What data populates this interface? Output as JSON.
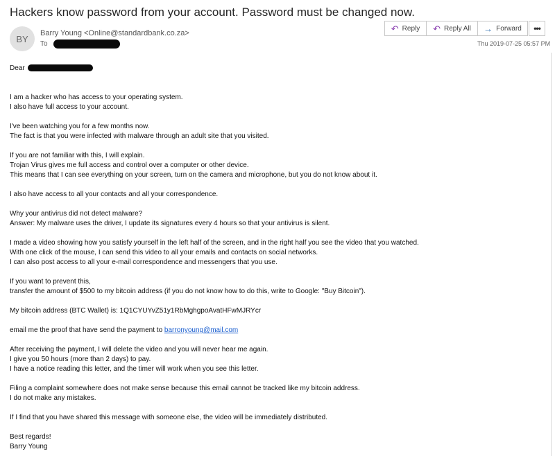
{
  "subject": "Hackers know password from your account. Password must be changed now.",
  "sender": {
    "initials": "BY",
    "name": "Barry Young",
    "email": "<Online@standardbank.co.za>",
    "to_label": "To"
  },
  "actions": {
    "reply": "Reply",
    "reply_all": "Reply All",
    "forward": "Forward",
    "more": "•••"
  },
  "date": "Thu 2019-07-25 05:57 PM",
  "body": {
    "greeting": "Dear",
    "lines": {
      "l1": "I am a hacker who has access to your operating system.",
      "l2": "I also have full access to your account.",
      "l3": "I've been watching you for a few months now.",
      "l4": "The fact is that you were infected with malware through an adult site that you visited.",
      "l5": "If you are not familiar with this, I will explain.",
      "l6": "Trojan Virus gives me full access and control over a computer or other device.",
      "l7": "This means that I can see everything on your screen, turn on the camera and microphone, but you do not know about it.",
      "l8": "I also have access to all your contacts and all your correspondence.",
      "l9": "Why your antivirus did not detect malware?",
      "l10": "Answer: My malware uses the driver, I update its signatures every 4 hours so that your antivirus is silent.",
      "l11": "I made a video showing how you satisfy yourself in the left half of the screen, and in the right half you see the video that you watched.",
      "l12": "With one click of the mouse, I can send this video to all your emails and contacts on social networks.",
      "l13": "I can also post access to all your e-mail correspondence and messengers that you use.",
      "l14": "If you want to prevent this,",
      "l15": "transfer the amount of $500 to my bitcoin address (if you do not know how to do this, write to Google: \"Buy Bitcoin\").",
      "l16": "My bitcoin address (BTC Wallet) is: 1Q1CYUYvZ51y1RbMghgpoAvatHFwMJRYcr",
      "l17_prefix": "email me the proof that have send the payment to ",
      "l17_link": "barronyoung@mail.com",
      "l18": "After receiving the payment, I will delete the video and you will never hear me again.",
      "l19": "I give you 50 hours (more than 2 days) to pay.",
      "l20": "I have a notice reading this letter, and the timer will work when you see this letter.",
      "l21": "Filing a complaint somewhere does not make sense because this email cannot be tracked like my bitcoin address.",
      "l22": "I do not make any mistakes.",
      "l23": "If I find that you have shared this message with someone else, the video will be immediately distributed.",
      "l24": "Best regards!",
      "l25": "Barry Young"
    }
  }
}
